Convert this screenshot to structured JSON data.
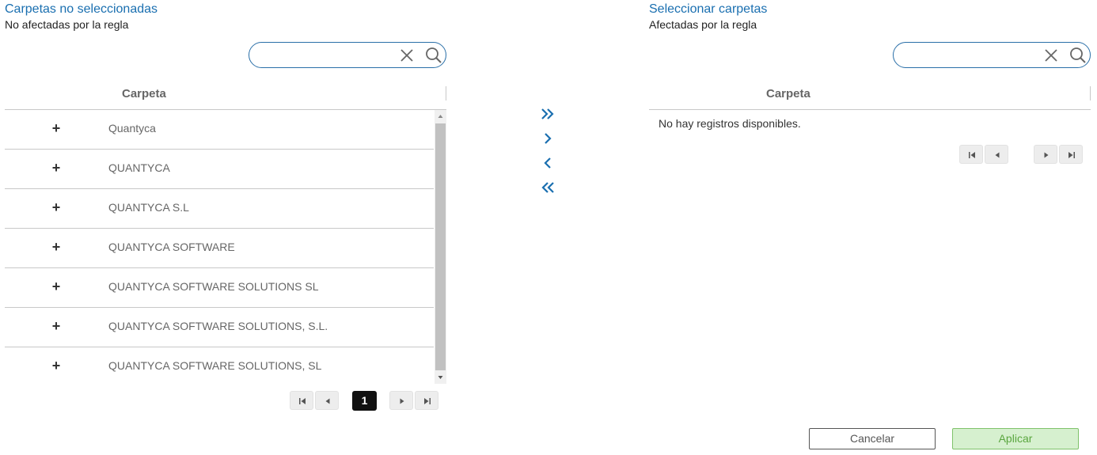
{
  "left_panel": {
    "title": "Carpetas no seleccionadas",
    "subtitle": "No afectadas por la regla",
    "search": {
      "value": "",
      "placeholder": ""
    },
    "column_header": "Carpeta",
    "rows": [
      {
        "expander": "+",
        "name": "Quantyca"
      },
      {
        "expander": "+",
        "name": "QUANTYCA"
      },
      {
        "expander": "+",
        "name": "QUANTYCA S.L"
      },
      {
        "expander": "+",
        "name": "QUANTYCA SOFTWARE"
      },
      {
        "expander": "+",
        "name": "QUANTYCA SOFTWARE SOLUTIONS SL"
      },
      {
        "expander": "+",
        "name": "QUANTYCA SOFTWARE SOLUTIONS, S.L."
      },
      {
        "expander": "+",
        "name": "QUANTYCA SOFTWARE SOLUTIONS, SL"
      }
    ],
    "pager": {
      "current_page": "1"
    }
  },
  "right_panel": {
    "title": "Seleccionar carpetas",
    "subtitle": "Afectadas por la regla",
    "search": {
      "value": "",
      "placeholder": ""
    },
    "column_header": "Carpeta",
    "empty_message": "No hay registros disponibles."
  },
  "transfer_controls": {
    "icons": [
      "double-chevron-right-icon",
      "chevron-right-icon",
      "chevron-left-icon",
      "double-chevron-left-icon"
    ]
  },
  "footer": {
    "cancel_label": "Cancelar",
    "apply_label": "Aplicar"
  },
  "colors": {
    "accent": "#1a6fb0",
    "apply_bg": "#d6f0cf",
    "apply_text": "#5aa63f"
  }
}
